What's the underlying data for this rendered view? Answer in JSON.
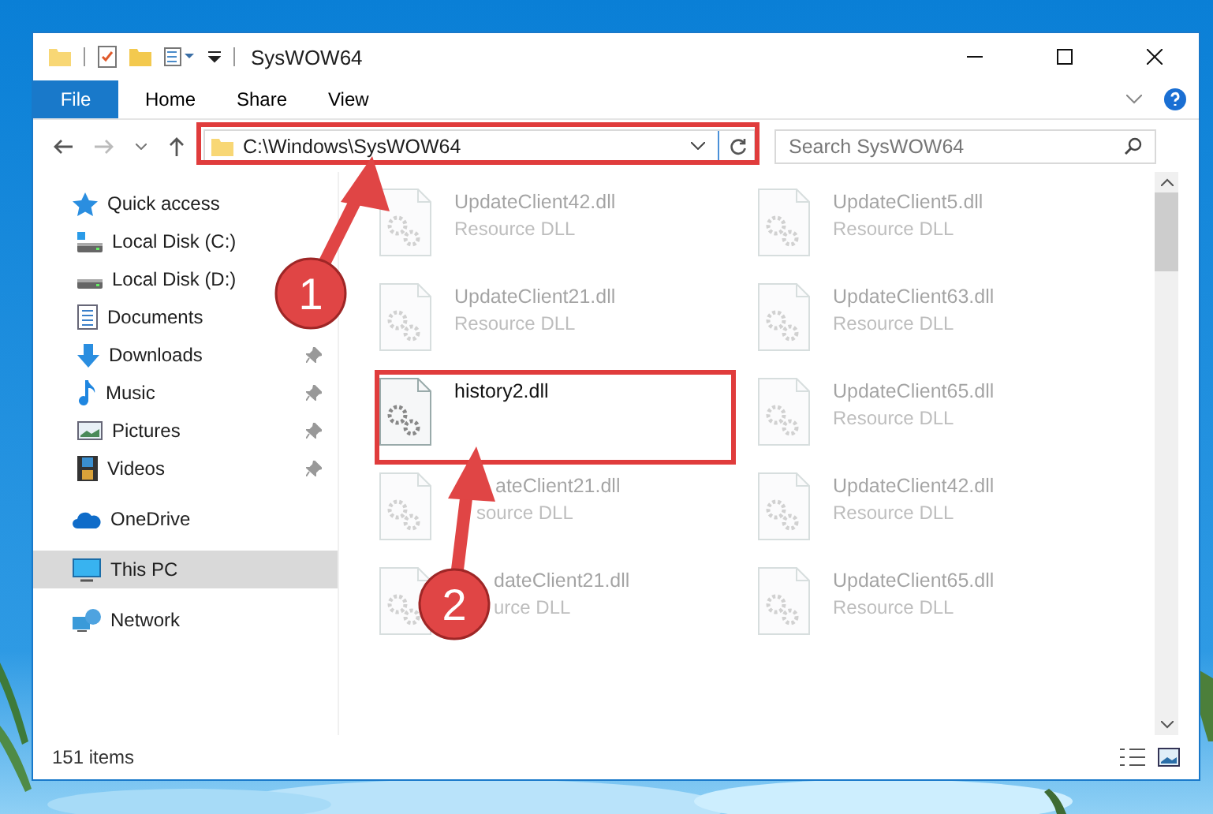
{
  "window": {
    "title": "SysWOW64"
  },
  "ribbon_tabs": [
    {
      "label": "File",
      "kind": "menu"
    },
    {
      "label": "Home",
      "kind": "tab"
    },
    {
      "label": "Share",
      "kind": "tab"
    },
    {
      "label": "View",
      "kind": "tab"
    }
  ],
  "address_bar": {
    "value": "C:\\Windows\\SysWOW64"
  },
  "search": {
    "placeholder": "Search SysWOW64"
  },
  "sidebar": {
    "items": [
      {
        "label": "Quick access",
        "kind": "star",
        "selected": false,
        "children": [
          {
            "label": "Local Disk (C:)",
            "kind": "drive-win",
            "pinned": false,
            "selected": false
          },
          {
            "label": "Local Disk (D:)",
            "kind": "drive",
            "pinned": false,
            "selected": false
          },
          {
            "label": "Documents",
            "kind": "documents",
            "pinned": false,
            "selected": false
          },
          {
            "label": "Downloads",
            "kind": "downloads",
            "pinned": true,
            "selected": false
          },
          {
            "label": "Music",
            "kind": "music",
            "pinned": true,
            "selected": false
          },
          {
            "label": "Pictures",
            "kind": "pictures",
            "pinned": true,
            "selected": false
          },
          {
            "label": "Videos",
            "kind": "videos",
            "pinned": true,
            "selected": false
          }
        ]
      },
      {
        "label": "OneDrive",
        "kind": "cloud",
        "selected": false
      },
      {
        "label": "This PC",
        "kind": "pc",
        "selected": true
      },
      {
        "label": "Network",
        "kind": "network",
        "selected": false
      }
    ]
  },
  "files": [
    {
      "name": "UpdateClient42.dll",
      "type": "Resource DLL",
      "faded": true
    },
    {
      "name": "UpdateClient5.dll",
      "type": "Resource DLL",
      "faded": true
    },
    {
      "name": "UpdateClient21.dll",
      "type": "Resource DLL",
      "faded": true
    },
    {
      "name": "UpdateClient63.dll",
      "type": "Resource DLL",
      "faded": true
    },
    {
      "name": "history2.dll",
      "faded": false
    },
    {
      "name": "UpdateClient65.dll",
      "type": "Resource DLL",
      "faded": true
    },
    {
      "name": "ateClient21.dll",
      "type": "source DLL",
      "faded": true
    },
    {
      "name": "UpdateClient42.dll",
      "type": "Resource DLL",
      "faded": true
    },
    {
      "name": "dateClient21.dll",
      "type": "urce DLL",
      "faded": true
    },
    {
      "name": "UpdateClient65.dll",
      "type": "Resource DLL",
      "faded": true
    }
  ],
  "status_bar": {
    "count": "151 items"
  },
  "annotations": [
    {
      "label": "1"
    },
    {
      "label": "2"
    }
  ]
}
